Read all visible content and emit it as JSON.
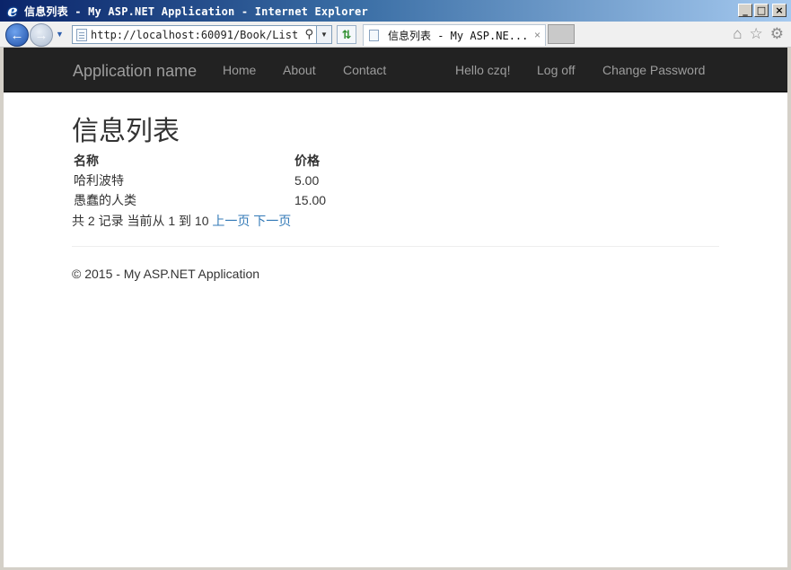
{
  "window": {
    "title": "信息列表 - My ASP.NET Application - Internet Explorer",
    "minimize": "_",
    "maximize": "□",
    "close": "×"
  },
  "browser": {
    "address": "http://localhost:60091/Book/List",
    "tab_title": "信息列表 - My ASP.NE...",
    "tab_close": "×",
    "icons": [
      "back-icon",
      "forward-icon",
      "home-icon",
      "favorites-star-icon",
      "settings-gear-icon"
    ]
  },
  "navbar": {
    "brand": "Application name",
    "links": [
      "Home",
      "About",
      "Contact"
    ],
    "greeting": "Hello czq!",
    "logoff": "Log off",
    "change_password": "Change Password"
  },
  "main": {
    "title": "信息列表",
    "table": {
      "headers": [
        "名称",
        "价格"
      ],
      "rows": [
        [
          "哈利波特",
          "5.00"
        ],
        [
          "愚蠢的人类",
          "15.00"
        ]
      ]
    },
    "pager": {
      "summary": "共 2 记录 当前从 1 到 10",
      "prev": "上一页",
      "next": "下一页"
    }
  },
  "footer": {
    "text": "© 2015 - My ASP.NET Application"
  },
  "colors": {
    "navbar_bg": "#222222",
    "nav_text": "#9d9d9d",
    "link": "#337ab7",
    "text": "#333333"
  }
}
